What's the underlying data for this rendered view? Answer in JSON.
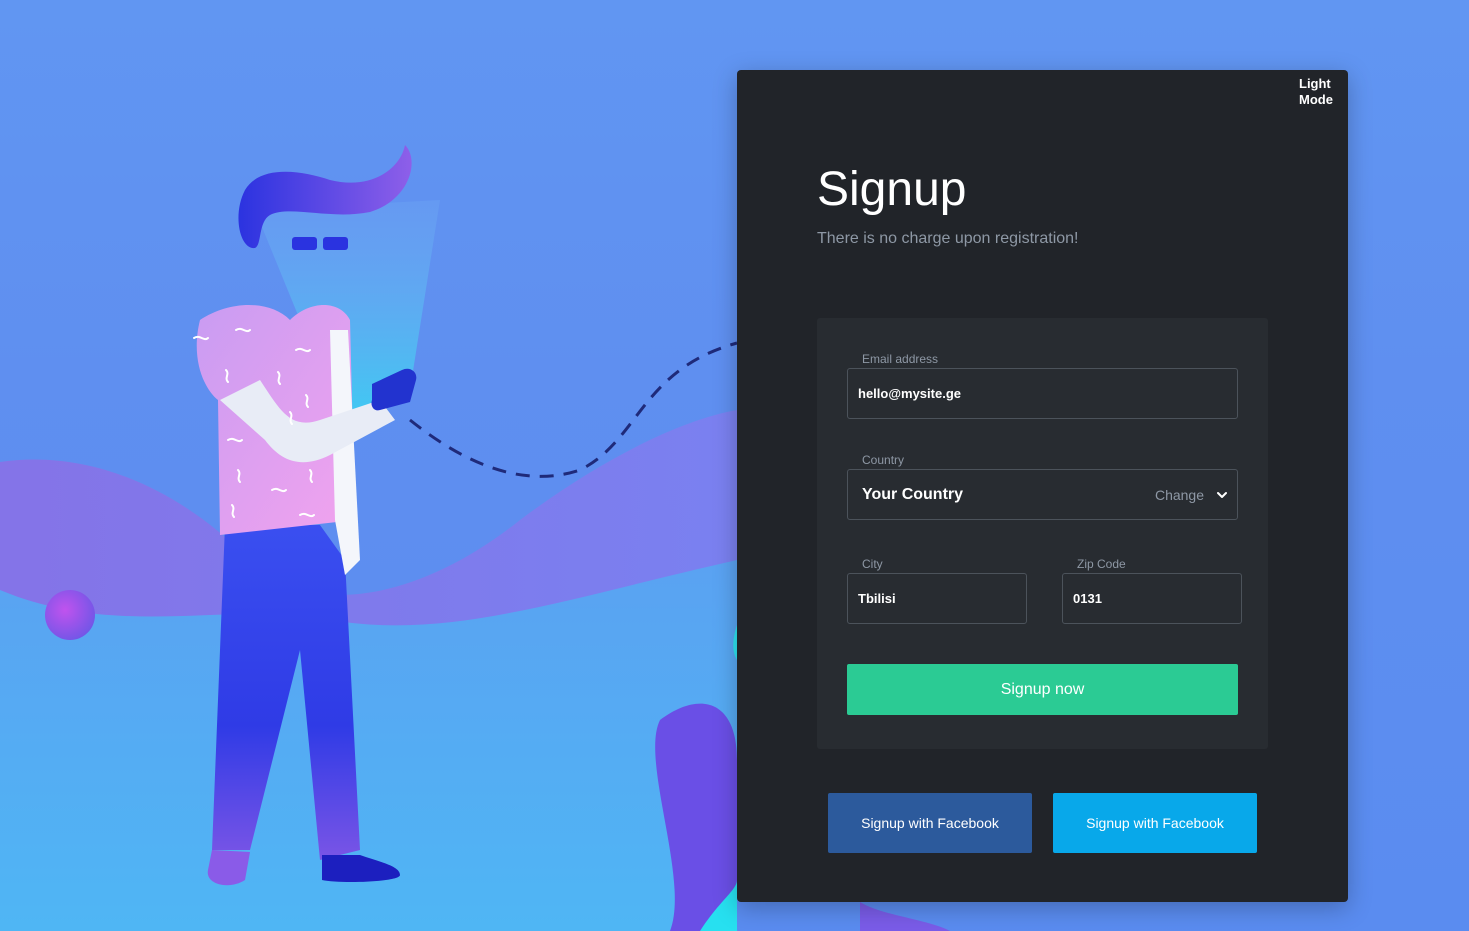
{
  "theme_toggle": {
    "label": "Light Mode"
  },
  "header": {
    "title": "Signup",
    "subtitle": "There is no charge upon registration!"
  },
  "form": {
    "email": {
      "label": "Email address",
      "value": "hello@mysite.ge"
    },
    "country": {
      "label": "Country",
      "value": "Your Country",
      "action": "Change"
    },
    "city": {
      "label": "City",
      "value": "Tbilisi"
    },
    "zip": {
      "label": "Zip Code",
      "value": "0131"
    },
    "submit_label": "Signup now"
  },
  "social": {
    "facebook_dark_label": "Signup with Facebook",
    "facebook_light_label": "Signup with Facebook"
  },
  "colors": {
    "background": "#6196f2",
    "card": "#212429",
    "panel": "#282c31",
    "primary": "#2bcb94",
    "facebook_dark": "#2c5a9c",
    "facebook_light": "#08a8ea"
  }
}
